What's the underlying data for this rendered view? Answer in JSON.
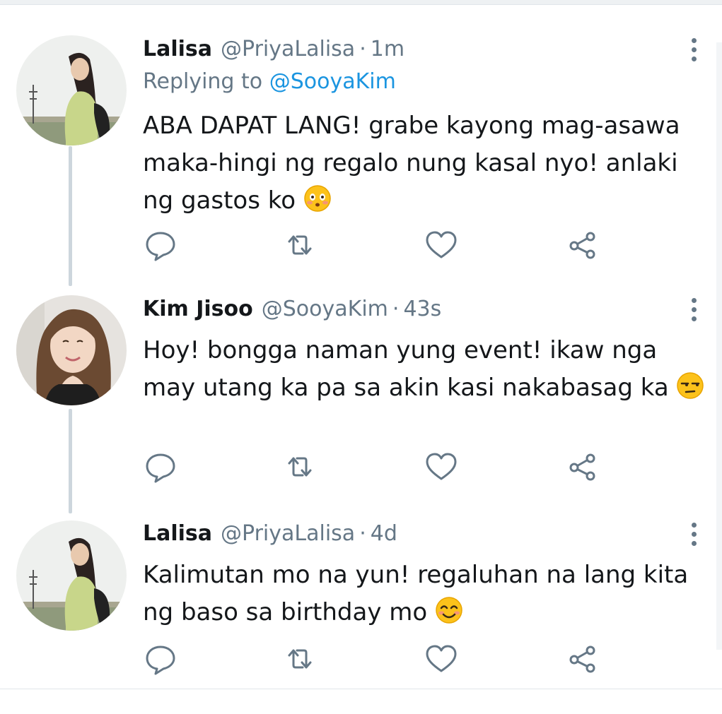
{
  "colors": {
    "text": "#14171a",
    "secondary": "#657786",
    "link": "#1b95e0",
    "thread_line": "#cdd6dd"
  },
  "tweets": [
    {
      "name": "Lalisa",
      "handle": "@PriyaLalisa",
      "dot": "·",
      "time": "1m",
      "reply_prefix": "Replying to",
      "reply_to": "@SooyaKim",
      "text": "ABA DAPAT LANG! grabe kayong mag-asawa maka-hingi ng regalo nung kasal nyo! anlaki ng gastos ko",
      "emoji": "flushed-face-icon"
    },
    {
      "name": "Kim Jisoo",
      "handle": "@SooyaKim",
      "dot": "·",
      "time": "43s",
      "text": "Hoy! bongga naman yung event! ikaw nga may utang ka pa sa akin kasi nakabasag ka",
      "emoji": "unamused-face-icon"
    },
    {
      "name": "Lalisa",
      "handle": "@PriyaLalisa",
      "dot": "·",
      "time": "4d",
      "text": "Kalimutan mo na yun! regaluhan na lang kita ng baso sa birthday mo",
      "emoji": "smiling-face-icon"
    }
  ],
  "action_icons": [
    "reply-icon",
    "retweet-icon",
    "like-icon",
    "share-icon"
  ]
}
